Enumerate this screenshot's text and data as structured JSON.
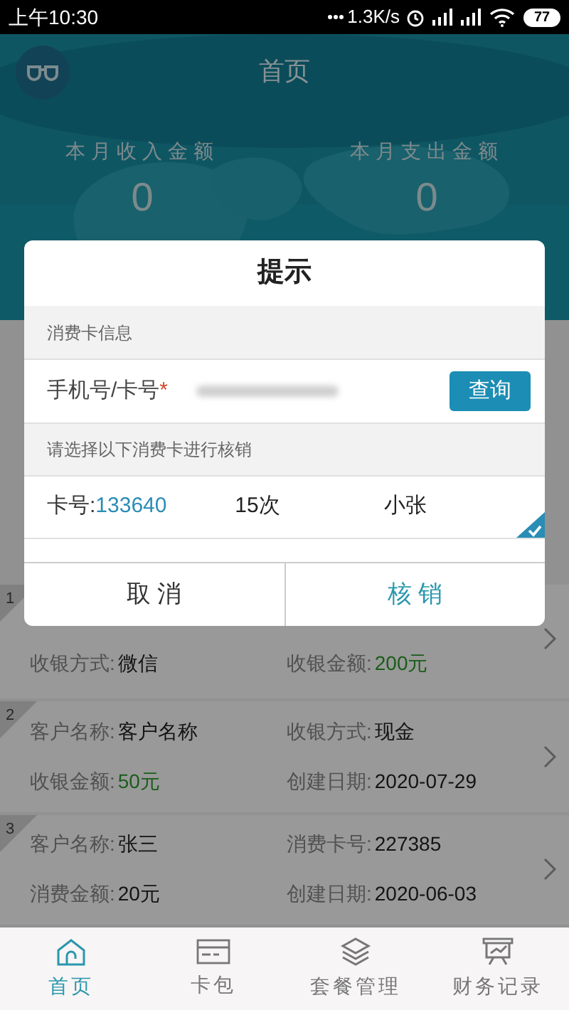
{
  "status_bar": {
    "time": "上午10:30",
    "network_speed": "1.3K/s",
    "battery": "77"
  },
  "header": {
    "title": "首页",
    "stats": [
      {
        "label": "本月收入金额",
        "value": "0"
      },
      {
        "label": "本月支出金额",
        "value": "0"
      }
    ]
  },
  "records": [
    {
      "index": "1",
      "fields": [
        {
          "label": "收银方式:",
          "value": "微信",
          "kind": "plain"
        },
        {
          "label": "收银金额:",
          "value": "200元",
          "kind": "amount"
        }
      ]
    },
    {
      "index": "2",
      "fields": [
        {
          "label": "客户名称:",
          "value": "客户名称",
          "kind": "plain"
        },
        {
          "label": "收银方式:",
          "value": "现金",
          "kind": "plain"
        },
        {
          "label": "收银金额:",
          "value": "50元",
          "kind": "amount"
        },
        {
          "label": "创建日期:",
          "value": "2020-07-29",
          "kind": "plain"
        }
      ]
    },
    {
      "index": "3",
      "fields": [
        {
          "label": "客户名称:",
          "value": "张三",
          "kind": "plain"
        },
        {
          "label": "消费卡号:",
          "value": "227385",
          "kind": "plain"
        },
        {
          "label": "消费金额:",
          "value": "20元",
          "kind": "plain"
        },
        {
          "label": "创建日期:",
          "value": "2020-06-03",
          "kind": "plain"
        }
      ]
    }
  ],
  "dialog": {
    "title": "提示",
    "section_label": "消费卡信息",
    "phone_label": "手机号/卡号",
    "required_mark": "*",
    "query_button": "查询",
    "hint": "请选择以下消费卡进行核销",
    "cards": [
      {
        "card_label": "卡号:",
        "card_number": "133640",
        "count": "15次",
        "name": "小张",
        "selected": true
      }
    ],
    "buttons": [
      {
        "label": "取 消",
        "kind": "cancel"
      },
      {
        "label": "核 销",
        "kind": "confirm"
      }
    ]
  },
  "nav": [
    {
      "label": "首页",
      "kind": "home",
      "selected": true
    },
    {
      "label": "卡包",
      "kind": "card",
      "selected": false
    },
    {
      "label": "套餐管理",
      "kind": "layers",
      "selected": false
    },
    {
      "label": "财务记录",
      "kind": "board",
      "selected": false
    }
  ]
}
